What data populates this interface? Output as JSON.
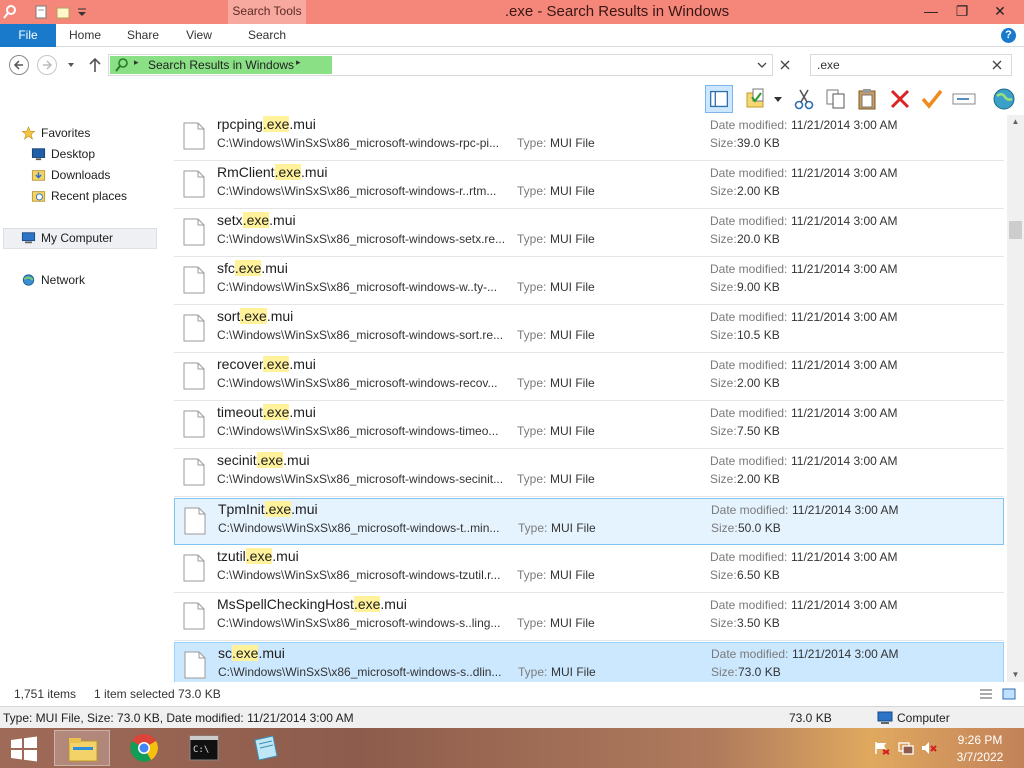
{
  "window": {
    "title": ".exe - Search Results in Windows",
    "context_tab": "Search Tools",
    "controls": {
      "minimize": "—",
      "maximize": "❐",
      "close": "✕"
    }
  },
  "ribbon": {
    "tabs": [
      "File",
      "Home",
      "Share",
      "View",
      "Search"
    ],
    "help": "?"
  },
  "address": {
    "location": "Search Results in Windows",
    "search_value": ".exe"
  },
  "toolbar": {
    "icons": [
      "preview-pane-icon",
      "properties-icon",
      "cut-icon",
      "copy-icon",
      "paste-icon",
      "delete-icon",
      "check-icon",
      "rename-icon",
      "globe-icon"
    ]
  },
  "navigation": {
    "favorites": "Favorites",
    "favorites_items": [
      "Desktop",
      "Downloads",
      "Recent places"
    ],
    "computer": "My Computer",
    "network": "Network"
  },
  "files": [
    {
      "pre": "rpcping",
      "hl": ".exe",
      "post": ".mui",
      "path": "C:\\Windows\\WinSxS\\x86_microsoft-windows-rpc-pi...",
      "type_label": "Type:",
      "type": "MUI File",
      "date_label": "Date modified:",
      "date": "11/21/2014 3:00 AM",
      "size_label": "Size:",
      "size": "39.0 KB"
    },
    {
      "pre": "RmClient",
      "hl": ".exe",
      "post": ".mui",
      "path": "C:\\Windows\\WinSxS\\x86_microsoft-windows-r..rtm...",
      "type_label": "Type:",
      "type": "MUI File",
      "date_label": "Date modified:",
      "date": "11/21/2014 3:00 AM",
      "size_label": "Size:",
      "size": "2.00 KB"
    },
    {
      "pre": "setx",
      "hl": ".exe",
      "post": ".mui",
      "path": "C:\\Windows\\WinSxS\\x86_microsoft-windows-setx.re...",
      "type_label": "Type:",
      "type": "MUI File",
      "date_label": "Date modified:",
      "date": "11/21/2014 3:00 AM",
      "size_label": "Size:",
      "size": "20.0 KB"
    },
    {
      "pre": "sfc",
      "hl": ".exe",
      "post": ".mui",
      "path": "C:\\Windows\\WinSxS\\x86_microsoft-windows-w..ty-...",
      "type_label": "Type:",
      "type": "MUI File",
      "date_label": "Date modified:",
      "date": "11/21/2014 3:00 AM",
      "size_label": "Size:",
      "size": "9.00 KB"
    },
    {
      "pre": "sort",
      "hl": ".exe",
      "post": ".mui",
      "path": "C:\\Windows\\WinSxS\\x86_microsoft-windows-sort.re...",
      "type_label": "Type:",
      "type": "MUI File",
      "date_label": "Date modified:",
      "date": "11/21/2014 3:00 AM",
      "size_label": "Size:",
      "size": "10.5 KB"
    },
    {
      "pre": "recover",
      "hl": ".exe",
      "post": ".mui",
      "path": "C:\\Windows\\WinSxS\\x86_microsoft-windows-recov...",
      "type_label": "Type:",
      "type": "MUI File",
      "date_label": "Date modified:",
      "date": "11/21/2014 3:00 AM",
      "size_label": "Size:",
      "size": "2.00 KB"
    },
    {
      "pre": "timeout",
      "hl": ".exe",
      "post": ".mui",
      "path": "C:\\Windows\\WinSxS\\x86_microsoft-windows-timeo...",
      "type_label": "Type:",
      "type": "MUI File",
      "date_label": "Date modified:",
      "date": "11/21/2014 3:00 AM",
      "size_label": "Size:",
      "size": "7.50 KB"
    },
    {
      "pre": "secinit",
      "hl": ".exe",
      "post": ".mui",
      "path": "C:\\Windows\\WinSxS\\x86_microsoft-windows-secinit...",
      "type_label": "Type:",
      "type": "MUI File",
      "date_label": "Date modified:",
      "date": "11/21/2014 3:00 AM",
      "size_label": "Size:",
      "size": "2.00 KB"
    },
    {
      "pre": "TpmInit",
      "hl": ".exe",
      "post": ".mui",
      "path": "C:\\Windows\\WinSxS\\x86_microsoft-windows-t..min...",
      "type_label": "Type:",
      "type": "MUI File",
      "date_label": "Date modified:",
      "date": "11/21/2014 3:00 AM",
      "size_label": "Size:",
      "size": "50.0 KB"
    },
    {
      "pre": "tzutil",
      "hl": ".exe",
      "post": ".mui",
      "path": "C:\\Windows\\WinSxS\\x86_microsoft-windows-tzutil.r...",
      "type_label": "Type:",
      "type": "MUI File",
      "date_label": "Date modified:",
      "date": "11/21/2014 3:00 AM",
      "size_label": "Size:",
      "size": "6.50 KB"
    },
    {
      "pre": "MsSpellCheckingHost",
      "hl": ".exe",
      "post": ".mui",
      "path": "C:\\Windows\\WinSxS\\x86_microsoft-windows-s..ling...",
      "type_label": "Type:",
      "type": "MUI File",
      "date_label": "Date modified:",
      "date": "11/21/2014 3:00 AM",
      "size_label": "Size:",
      "size": "3.50 KB"
    },
    {
      "pre": "sc",
      "hl": ".exe",
      "post": ".mui",
      "path": "C:\\Windows\\WinSxS\\x86_microsoft-windows-s..dlin...",
      "type_label": "Type:",
      "type": "MUI File",
      "date_label": "Date modified:",
      "date": "11/21/2014 3:00 AM",
      "size_label": "Size:",
      "size": "73.0 KB"
    }
  ],
  "status": {
    "count": "1,751 items",
    "selected": "1 item selected",
    "selected_size": "73.0 KB"
  },
  "details": {
    "text": "Type: MUI File, Size: 73.0 KB, Date modified: 11/21/2014 3:00 AM",
    "size": "73.0 KB",
    "computer": "Computer"
  },
  "taskbar": {
    "time": "9:26 PM",
    "date": "3/7/2022"
  },
  "colors": {
    "title_bar": "#f4877a",
    "file_tab": "#1979ca",
    "highlight": "#fff29a",
    "selection": "#cce8ff"
  }
}
